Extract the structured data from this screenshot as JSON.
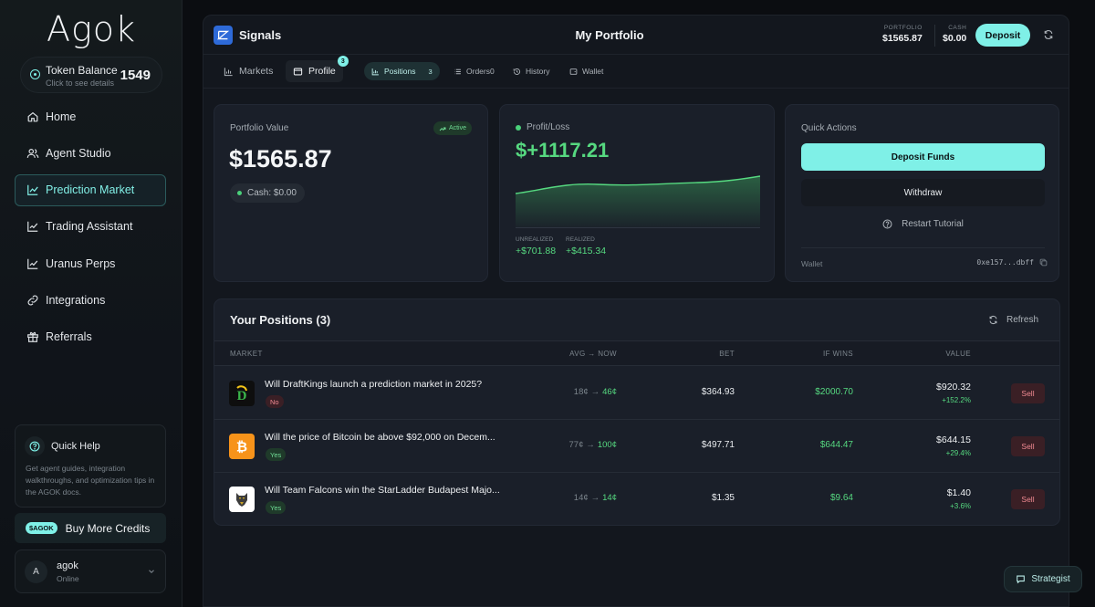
{
  "sidebar": {
    "logo": "Agok",
    "token": {
      "title": "Token Balance",
      "sub": "Click to see details",
      "value": "1549"
    },
    "nav": [
      {
        "label": "Home",
        "icon": "home-icon"
      },
      {
        "label": "Agent Studio",
        "icon": "users-icon"
      },
      {
        "label": "Prediction Market",
        "icon": "chart-line-icon",
        "active": true
      },
      {
        "label": "Trading Assistant",
        "icon": "trend-icon"
      },
      {
        "label": "Uranus Perps",
        "icon": "trend-icon"
      },
      {
        "label": "Integrations",
        "icon": "link-icon"
      },
      {
        "label": "Referrals",
        "icon": "gift-icon"
      }
    ],
    "help": {
      "title": "Quick Help",
      "text": "Get agent guides, integration walkthroughs, and optimization tips in the AGOK docs."
    },
    "credits": {
      "badge": "$AGOK",
      "label": "Buy More Credits"
    },
    "user": {
      "initial": "A",
      "name": "agok",
      "status": "Online"
    }
  },
  "topbar": {
    "brand": "Signals",
    "title": "My Portfolio",
    "portfolio_label": "PORTFOLIO",
    "portfolio_value": "$1565.87",
    "cash_label": "CASH",
    "cash_value": "$0.00",
    "deposit": "Deposit"
  },
  "tabs": {
    "markets": "Markets",
    "profile": "Profile",
    "profile_badge": "3",
    "positions": "Positions",
    "positions_count": "3",
    "orders": "Orders0",
    "history": "History",
    "wallet": "Wallet"
  },
  "portfolio_card": {
    "label": "Portfolio Value",
    "status": "Active",
    "value": "$1565.87",
    "cash": "Cash: $0.00"
  },
  "pl_card": {
    "label": "Profit/Loss",
    "value": "$+1117.21",
    "unrealized_label": "UNREALIZED",
    "unrealized_value": "+$701.88",
    "realized_label": "REALIZED",
    "realized_value": "+$415.34"
  },
  "quick_actions": {
    "label": "Quick Actions",
    "deposit": "Deposit Funds",
    "withdraw": "Withdraw",
    "tutorial": "Restart Tutorial",
    "wallet_label": "Wallet",
    "wallet_addr": "0xe157...dbff"
  },
  "positions": {
    "title": "Your Positions (3)",
    "refresh": "Refresh",
    "headers": {
      "market": "MARKET",
      "avg": "AVG → NOW",
      "bet": "BET",
      "ifwins": "IF WINS",
      "value": "VALUE"
    },
    "rows": [
      {
        "question": "Will DraftKings launch a prediction market in 2025?",
        "side": "No",
        "avg": "18¢",
        "now": "46¢",
        "bet": "$364.93",
        "ifwins": "$2000.70",
        "value": "$920.32",
        "pct": "+152.2%",
        "sell": "Sell",
        "icon": "draftkings-icon"
      },
      {
        "question": "Will the price of Bitcoin be above $92,000 on Decem...",
        "side": "Yes",
        "avg": "77¢",
        "now": "100¢",
        "bet": "$497.71",
        "ifwins": "$644.47",
        "value": "$644.15",
        "pct": "+29.4%",
        "sell": "Sell",
        "icon": "bitcoin-icon"
      },
      {
        "question": "Will Team Falcons win the StarLadder Budapest Majo...",
        "side": "Yes",
        "avg": "14¢",
        "now": "14¢",
        "bet": "$1.35",
        "ifwins": "$9.64",
        "value": "$1.40",
        "pct": "+3.6%",
        "sell": "Sell",
        "icon": "falcons-icon"
      }
    ]
  },
  "strategist": "Strategist",
  "colors": {
    "accent": "#7ff0e7",
    "profit": "#56d980",
    "loss": "#f08a92",
    "background": "#0b0d11",
    "card": "#1a1f29"
  }
}
